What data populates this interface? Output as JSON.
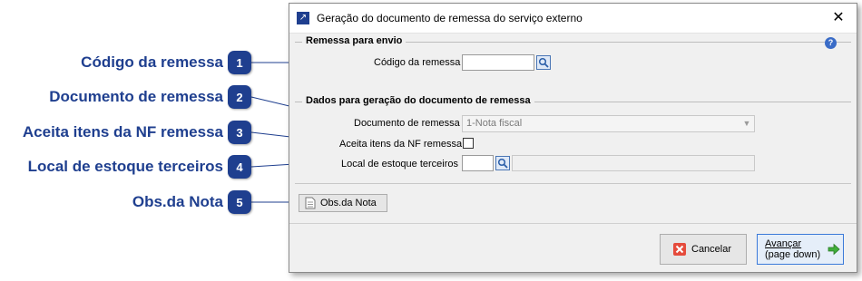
{
  "callouts": [
    {
      "number": "1",
      "label": "Código da remessa"
    },
    {
      "number": "2",
      "label": "Documento de remessa"
    },
    {
      "number": "3",
      "label": "Aceita itens da NF remessa"
    },
    {
      "number": "4",
      "label": "Local de estoque terceiros"
    },
    {
      "number": "5",
      "label": "Obs.da Nota"
    }
  ],
  "window": {
    "title": "Geração do documento de remessa do serviço externo",
    "close_symbol": "✕"
  },
  "group_envio": {
    "title": "Remessa para envio",
    "codigo_label": "Código da remessa",
    "codigo_value": ""
  },
  "group_dados": {
    "title": "Dados para geração do documento de remessa",
    "documento_label": "Documento de remessa",
    "documento_value": "1-Nota fiscal",
    "aceita_label": "Aceita itens da NF remessa",
    "aceita_checked": false,
    "local_label": "Local de estoque terceiros",
    "local_code": "",
    "local_desc": ""
  },
  "obs_button_label": "Obs.da Nota",
  "cancel_label": "Cancelar",
  "next_label_line1": "Avançar",
  "next_label_line2": "(page down)",
  "colors": {
    "accent": "#1f3f8f",
    "window_bg": "#f0f0f0"
  }
}
